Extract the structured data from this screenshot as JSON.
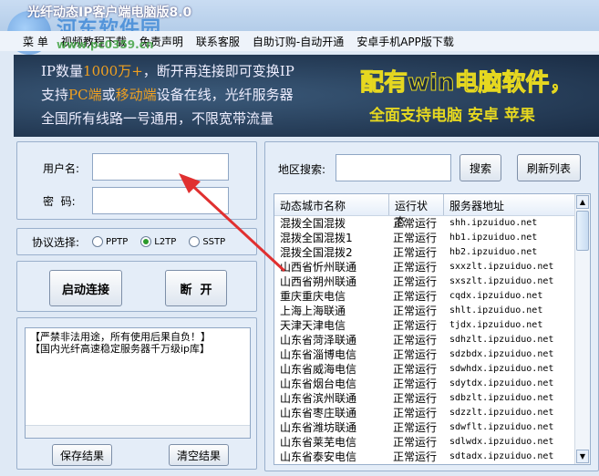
{
  "window": {
    "title": "光纤动态IP客户端电脑版8.0"
  },
  "watermark": {
    "name": "河东软件园",
    "url": "www.pc0359.cn"
  },
  "menu": [
    "菜 单",
    "视频教程下载",
    "免责声明",
    "联系客服",
    "自助订购-自动开通",
    "安卓手机APP版下载"
  ],
  "banner": {
    "line1": [
      "IP数量",
      "1000万+",
      "，断开再连接即可变换IP"
    ],
    "line2": [
      "支持",
      "PC端",
      "或",
      "移动端",
      "设备在线，光纤服务器"
    ],
    "line3": "全国所有线路一号通用，不限宽带流量",
    "right1": "配有win电脑软件，",
    "right2": "全面支持电脑 安卓 苹果"
  },
  "login": {
    "username_label": "用户名:",
    "password_label": "密  码:",
    "username": "",
    "password": ""
  },
  "protocol": {
    "label": "协议选择:",
    "options": [
      "PPTP",
      "L2TP",
      "SSTP"
    ],
    "selected": "L2TP"
  },
  "actions": {
    "connect": "启动连接",
    "disconnect": "断  开"
  },
  "log": {
    "lines": [
      "【严禁非法用途，所有使用后果自负！】",
      "【国内光纤高速稳定服务器千万级ip库】"
    ],
    "save": "保存结果",
    "clear": "清空结果"
  },
  "search": {
    "label": "地区搜索:",
    "value": "",
    "search_button": "搜索",
    "refresh_button": "刷新列表"
  },
  "table": {
    "headers": [
      "动态城市名称",
      "运行状态",
      "服务器地址"
    ],
    "rows": [
      [
        "混拨全国混拨",
        "正常运行",
        "shh.ipzuiduo.net"
      ],
      [
        "混拨全国混拨1",
        "正常运行",
        "hb1.ipzuiduo.net"
      ],
      [
        "混拨全国混拨2",
        "正常运行",
        "hb2.ipzuiduo.net"
      ],
      [
        "山西省忻州联通",
        "正常运行",
        "sxxzlt.ipzuiduo.net"
      ],
      [
        "山西省朔州联通",
        "正常运行",
        "sxszlt.ipzuiduo.net"
      ],
      [
        "重庆重庆电信",
        "正常运行",
        "cqdx.ipzuiduo.net"
      ],
      [
        "上海上海联通",
        "正常运行",
        "shlt.ipzuiduo.net"
      ],
      [
        "天津天津电信",
        "正常运行",
        "tjdx.ipzuiduo.net"
      ],
      [
        "山东省菏泽联通",
        "正常运行",
        "sdhzlt.ipzuiduo.net"
      ],
      [
        "山东省淄博电信",
        "正常运行",
        "sdzbdx.ipzuiduo.net"
      ],
      [
        "山东省威海电信",
        "正常运行",
        "sdwhdx.ipzuiduo.net"
      ],
      [
        "山东省烟台电信",
        "正常运行",
        "sdytdx.ipzuiduo.net"
      ],
      [
        "山东省滨州联通",
        "正常运行",
        "sdbzlt.ipzuiduo.net"
      ],
      [
        "山东省枣庄联通",
        "正常运行",
        "sdzzlt.ipzuiduo.net"
      ],
      [
        "山东省潍坊联通",
        "正常运行",
        "sdwflt.ipzuiduo.net"
      ],
      [
        "山东省莱芜电信",
        "正常运行",
        "sdlwdx.ipzuiduo.net"
      ],
      [
        "山东省泰安电信",
        "正常运行",
        "sdtadx.ipzuiduo.net"
      ]
    ]
  }
}
